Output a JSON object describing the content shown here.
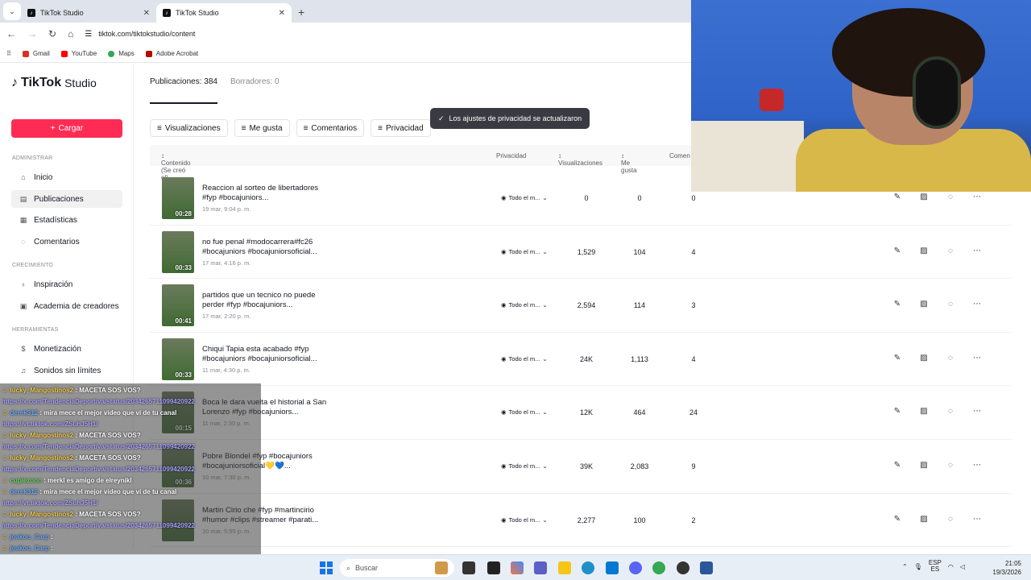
{
  "browser": {
    "tabs": [
      {
        "title": "TikTok Studio"
      },
      {
        "title": "TikTok Studio"
      }
    ],
    "url": "tiktok.com/tiktokstudio/content",
    "bookmarks": [
      {
        "label": "Gmail",
        "color": "#d93025"
      },
      {
        "label": "YouTube",
        "color": "#ff0000"
      },
      {
        "label": "Maps",
        "color": "#34a853"
      },
      {
        "label": "Adobe Acrobat",
        "color": "#b30b00"
      }
    ]
  },
  "sidebar": {
    "logo": "TikTok",
    "logo_suffix": "Studio",
    "upload": "Cargar",
    "sections": {
      "admin": "ADMINISTRAR",
      "growth": "CRECIMIENTO",
      "tools": "HERRAMIENTAS"
    },
    "items": [
      {
        "label": "Inicio",
        "icon": "home-icon"
      },
      {
        "label": "Publicaciones",
        "icon": "posts-icon"
      },
      {
        "label": "Estadísticas",
        "icon": "analytics-icon"
      },
      {
        "label": "Comentarios",
        "icon": "comments-icon"
      },
      {
        "label": "Inspiración",
        "icon": "bulb-icon"
      },
      {
        "label": "Academia de creadores",
        "icon": "academy-icon"
      },
      {
        "label": "Monetización",
        "icon": "money-icon"
      },
      {
        "label": "Sonidos sin límites",
        "icon": "sound-icon"
      }
    ]
  },
  "content": {
    "tab_posts": "Publicaciones: 384",
    "tab_drafts": "Borradores: 0",
    "filters": [
      "Visualizaciones",
      "Me gusta",
      "Comentarios",
      "Privacidad"
    ],
    "toast": "Los ajustes de privacidad se actualizaron",
    "columns": {
      "content": "Contenido (Se creó el)",
      "privacy": "Privacidad",
      "views": "Visualizaciones",
      "likes": "Me gusta",
      "comments": "Comen"
    },
    "rows": [
      {
        "title": "Reaccion al sorteo de libertadores #fyp #bocajuniors...",
        "date": "19 mar, 9:04 p. m.",
        "dur": "00:28",
        "privacy": "Todo el m...",
        "views": "0",
        "likes": "0",
        "comments": "0"
      },
      {
        "title": "no fue penal #modocarrera#fc26 #bocajuniors #bocajuniorsoficial...",
        "date": "17 mar, 4:16 p. m.",
        "dur": "00:33",
        "privacy": "Todo el m...",
        "views": "1,529",
        "likes": "104",
        "comments": "4"
      },
      {
        "title": "partidos que un tecnico no puede perder #fyp #bocajuniors...",
        "date": "17 mar, 2:20 p. m.",
        "dur": "00:41",
        "privacy": "Todo el m...",
        "views": "2,594",
        "likes": "114",
        "comments": "3"
      },
      {
        "title": "Chiqui Tapia esta acabado #fyp #bocajuniors #bocajuniorsoficial...",
        "date": "11 mar, 4:30 p. m.",
        "dur": "00:33",
        "privacy": "Todo el m...",
        "views": "24K",
        "likes": "1,113",
        "comments": "4"
      },
      {
        "title": "Boca le dara vuelta el historial a San Lorenzo #fyp #bocajuniors...",
        "date": "11 mar, 2:30 p. m.",
        "dur": "00:15",
        "privacy": "Todo el m...",
        "views": "12K",
        "likes": "464",
        "comments": "24"
      },
      {
        "title": "Pobre Blondel #fyp #bocajuniors #bocajuniorsoficial💛💙...",
        "date": "10 mar, 7:30 p. m.",
        "dur": "00:36",
        "privacy": "Todo el m...",
        "views": "39K",
        "likes": "2,083",
        "comments": "9"
      },
      {
        "title": "Martin Cirio che #fyp #martincirio #humor #clips #streamer #parati...",
        "date": "10 mar, 5:55 p. m.",
        "dur": "",
        "privacy": "Todo el m...",
        "views": "2,277",
        "likes": "100",
        "comments": "2"
      }
    ]
  },
  "chat": [
    {
      "user": "lucky_Mangostinos2",
      "msg": "MACETA SOS VOS?",
      "cls": "u"
    },
    {
      "user": "",
      "msg": "https://x.com/TendenciaDeportiva/status/2034265711099420922",
      "cls": "lk"
    },
    {
      "user": "derek312",
      "msg": "mira mece el mejor video que vi de tu canal",
      "cls": "u3"
    },
    {
      "user": "",
      "msg": "https://vt.tiktok.com/ZSuhJ5H1/",
      "cls": "lk"
    },
    {
      "user": "lucky_Mangostinos2",
      "msg": "MACETA SOS VOS?",
      "cls": "u"
    },
    {
      "user": "",
      "msg": "https://x.com/TendenciaDeportiva/status/2034265711099420922",
      "cls": "lk"
    },
    {
      "user": "lucky_Mangostinos2",
      "msg": "MACETA SOS VOS?",
      "cls": "u"
    },
    {
      "user": "",
      "msg": "https://x.com/TendenciaDeportiva/status/2034265711099420922",
      "cls": "lk"
    },
    {
      "user": "cupiezonn",
      "msg": "merkl es amigo de elreynikl",
      "cls": "u2"
    },
    {
      "user": "derek312",
      "msg": "mira mece el mejor video que vi de tu canal",
      "cls": "u3"
    },
    {
      "user": "",
      "msg": "https://vt.tiktok.com/ZSuhJ5H1/",
      "cls": "lk"
    },
    {
      "user": "lucky_Mangostinos2",
      "msg": "MACETA SOS VOS?",
      "cls": "u"
    },
    {
      "user": "",
      "msg": "https://x.com/TendenciaDeportiva/status/2034265711099420922",
      "cls": "lk"
    },
    {
      "user": "joakoo_Carp",
      "msg": "",
      "cls": "u3"
    },
    {
      "user": "joakoo_Carp",
      "msg": "",
      "cls": "u3"
    },
    {
      "user": "joakoo_Carp",
      "msg": "",
      "cls": "u3"
    },
    {
      "user": "cupiezonn",
      "msg": "merkl es amigo de elreynikl",
      "cls": "u2"
    }
  ],
  "taskbar": {
    "search": "Buscar",
    "lang": "ESP",
    "lang2": "ES",
    "time": "21:05",
    "date": "19/3/2026"
  }
}
